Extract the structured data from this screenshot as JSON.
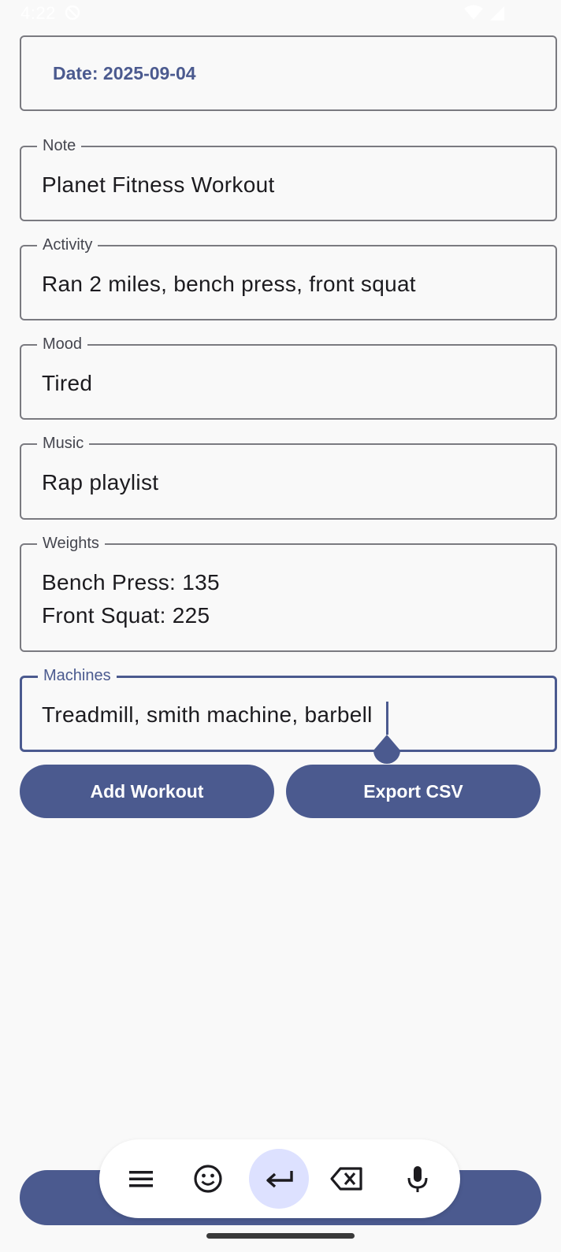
{
  "status_bar": {
    "time": "4:22"
  },
  "date_button": {
    "label": "Date: 2025-09-04"
  },
  "fields": {
    "note": {
      "label": "Note",
      "value": "Planet Fitness Workout"
    },
    "activity": {
      "label": "Activity",
      "value": "Ran 2 miles, bench press, front squat"
    },
    "mood": {
      "label": "Mood",
      "value": "Tired"
    },
    "music": {
      "label": "Music",
      "value": "Rap playlist"
    },
    "weights": {
      "label": "Weights",
      "value": "Bench Press: 135\nFront Squat: 225"
    },
    "machines": {
      "label": "Machines",
      "value": "Treadmill, smith machine, barbell"
    }
  },
  "buttons": {
    "add_workout": "Add Workout",
    "export_csv": "Export CSV"
  },
  "keyboard_toolbar": {
    "icons": [
      "menu-icon",
      "emoji-icon",
      "enter-icon",
      "backspace-icon",
      "microphone-icon"
    ]
  },
  "colors": {
    "primary": "#4b5a8f",
    "background": "#f9f9f9",
    "outline": "#7a7a80",
    "enter_highlight": "#dde1ff"
  }
}
